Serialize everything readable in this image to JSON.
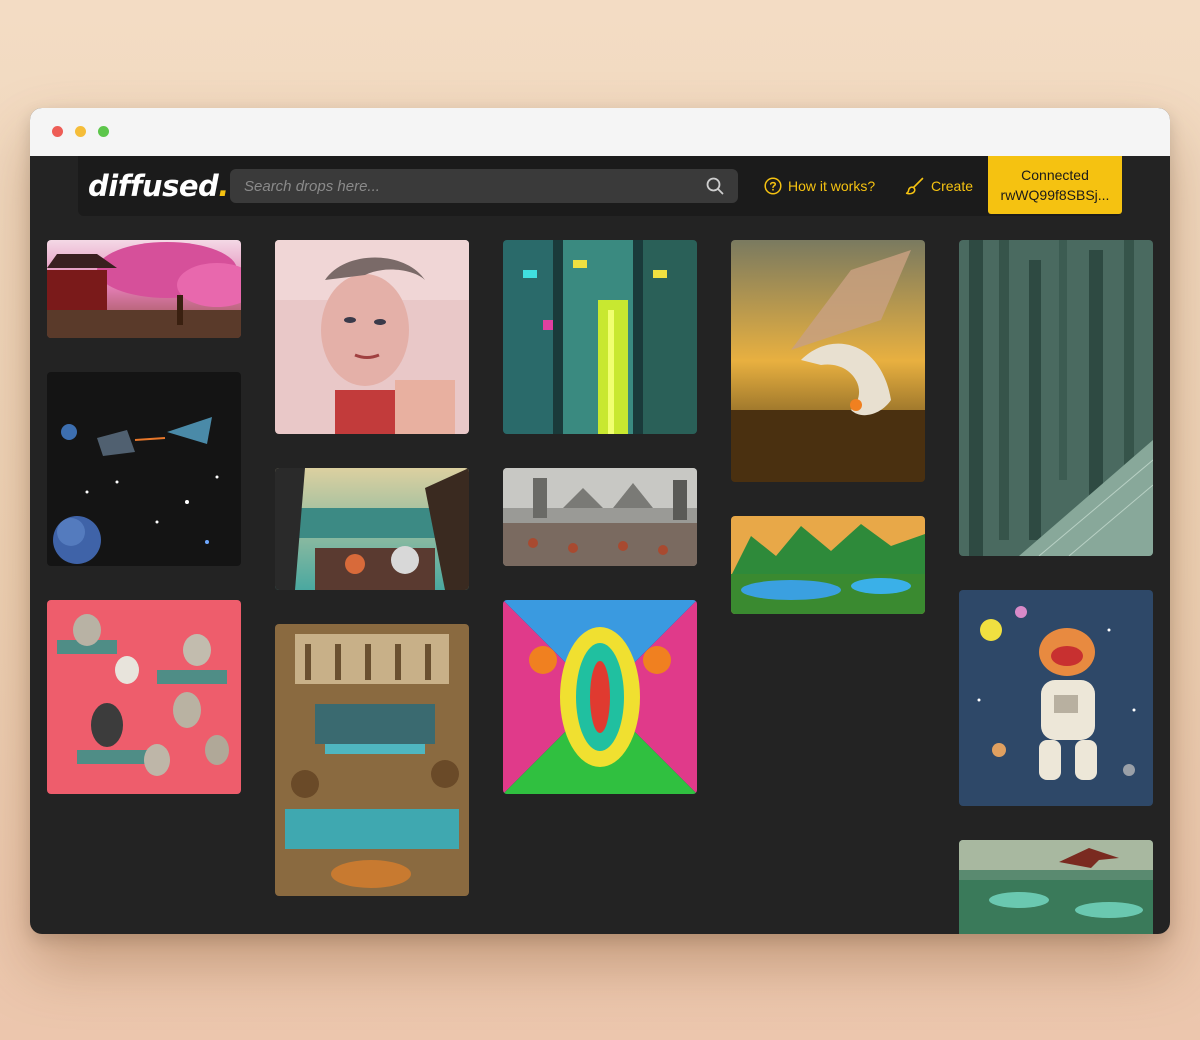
{
  "app": {
    "logo_text": "diffused",
    "logo_dot": ".",
    "accent_color": "#f5c211"
  },
  "search": {
    "placeholder": "Search drops here...",
    "value": ""
  },
  "nav": {
    "how_it_works": "How it works?",
    "create": "Create"
  },
  "wallet": {
    "status": "Connected",
    "address": "rwWQ99f8SBSj..."
  },
  "icons": {
    "search": "search-icon",
    "help": "question-circle-icon",
    "create": "paintbrush-icon"
  },
  "gallery": {
    "items": [
      {
        "subject": "cherry-blossom-temple"
      },
      {
        "subject": "space-battle"
      },
      {
        "subject": "cats-on-pink-pattern"
      },
      {
        "subject": "woman-portrait"
      },
      {
        "subject": "cockpit-futuristic-city"
      },
      {
        "subject": "ancient-temple-pool"
      },
      {
        "subject": "neon-cyberpunk-city"
      },
      {
        "subject": "castle-battle"
      },
      {
        "subject": "psychedelic-symmetry"
      },
      {
        "subject": "dragon-sunset"
      },
      {
        "subject": "green-mountains-lake"
      },
      {
        "subject": "grey-skyscraper-forest"
      },
      {
        "subject": "astronaut-cat"
      },
      {
        "subject": "pterodactyl-landscape"
      }
    ]
  }
}
